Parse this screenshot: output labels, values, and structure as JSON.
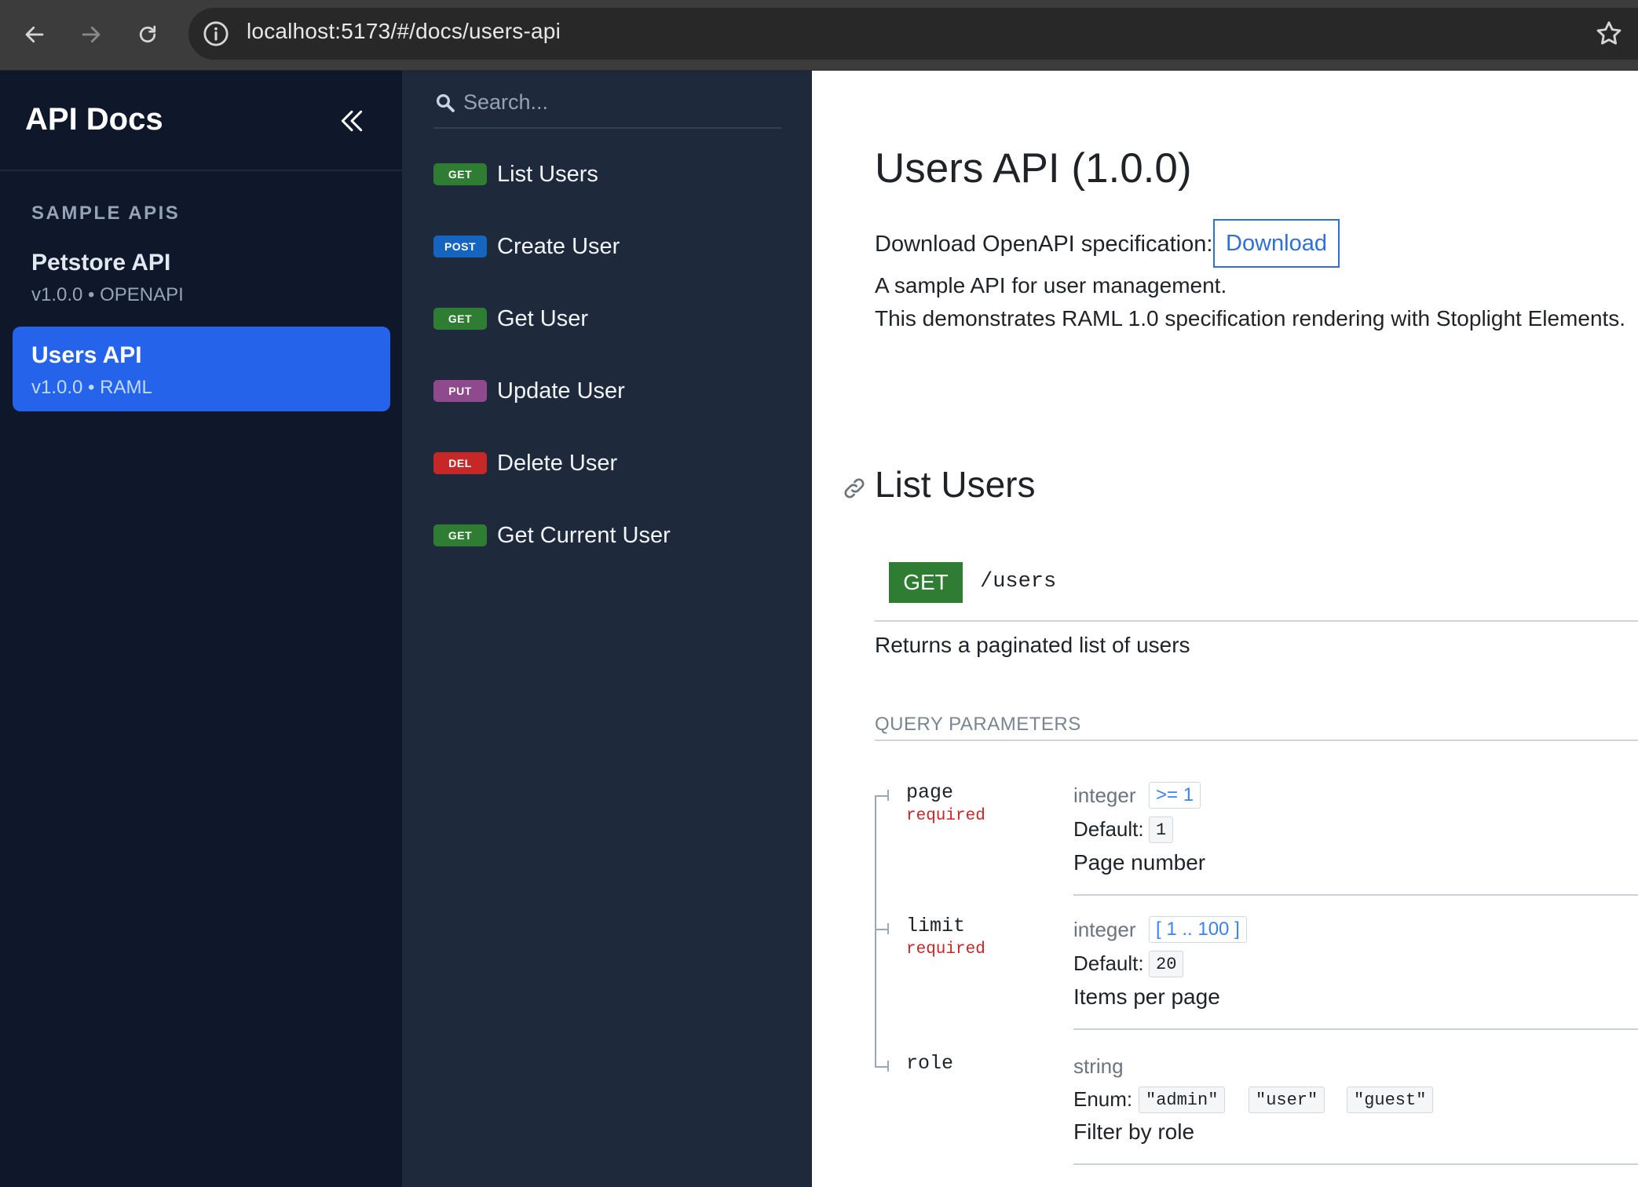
{
  "browser": {
    "url": "localhost:5173/#/docs/users-api"
  },
  "sidebar": {
    "title": "API Docs",
    "section_label": "SAMPLE APIS",
    "apis": [
      {
        "name": "Petstore API",
        "meta": "v1.0.0 • OPENAPI",
        "active": false
      },
      {
        "name": "Users API",
        "meta": "v1.0.0 • RAML",
        "active": true
      }
    ]
  },
  "operations": {
    "search_placeholder": "Search...",
    "items": [
      {
        "method": "GET",
        "label": "List Users",
        "color": "#2e7d32"
      },
      {
        "method": "POST",
        "label": "Create User",
        "color": "#1565c0"
      },
      {
        "method": "GET",
        "label": "Get User",
        "color": "#2e7d32"
      },
      {
        "method": "PUT",
        "label": "Update User",
        "color": "#8e4a8c"
      },
      {
        "method": "DEL",
        "label": "Delete User",
        "color": "#c62828"
      },
      {
        "method": "GET",
        "label": "Get Current User",
        "color": "#2e7d32"
      }
    ]
  },
  "main": {
    "title": "Users API (1.0.0)",
    "download_label": "Download OpenAPI specification:",
    "download_button": "Download",
    "description_line1": "A sample API for user management.",
    "description_line2": "This demonstrates RAML 1.0 specification rendering with Stoplight Elements.",
    "section_title": "List Users",
    "method": "GET",
    "path": "/users",
    "operation_description": "Returns a paginated list of users",
    "query_params_title": "QUERY PARAMETERS",
    "default_label": "Default:",
    "enum_label": "Enum:",
    "params": {
      "page": {
        "name": "page",
        "required": "required",
        "type": "integer",
        "constraint": ">= 1",
        "default": "1",
        "description": "Page number"
      },
      "limit": {
        "name": "limit",
        "required": "required",
        "type": "integer",
        "constraint": "[ 1 .. 100 ]",
        "default": "20",
        "description": "Items per page"
      },
      "role": {
        "name": "role",
        "type": "string",
        "enum": [
          "\"admin\"",
          "\"user\"",
          "\"guest\""
        ],
        "description": "Filter by role"
      }
    }
  },
  "colors": {
    "accent": "#2563eb",
    "get": "#2e7d32",
    "post": "#1565c0",
    "put": "#8e4a8c",
    "delete": "#c62828"
  }
}
